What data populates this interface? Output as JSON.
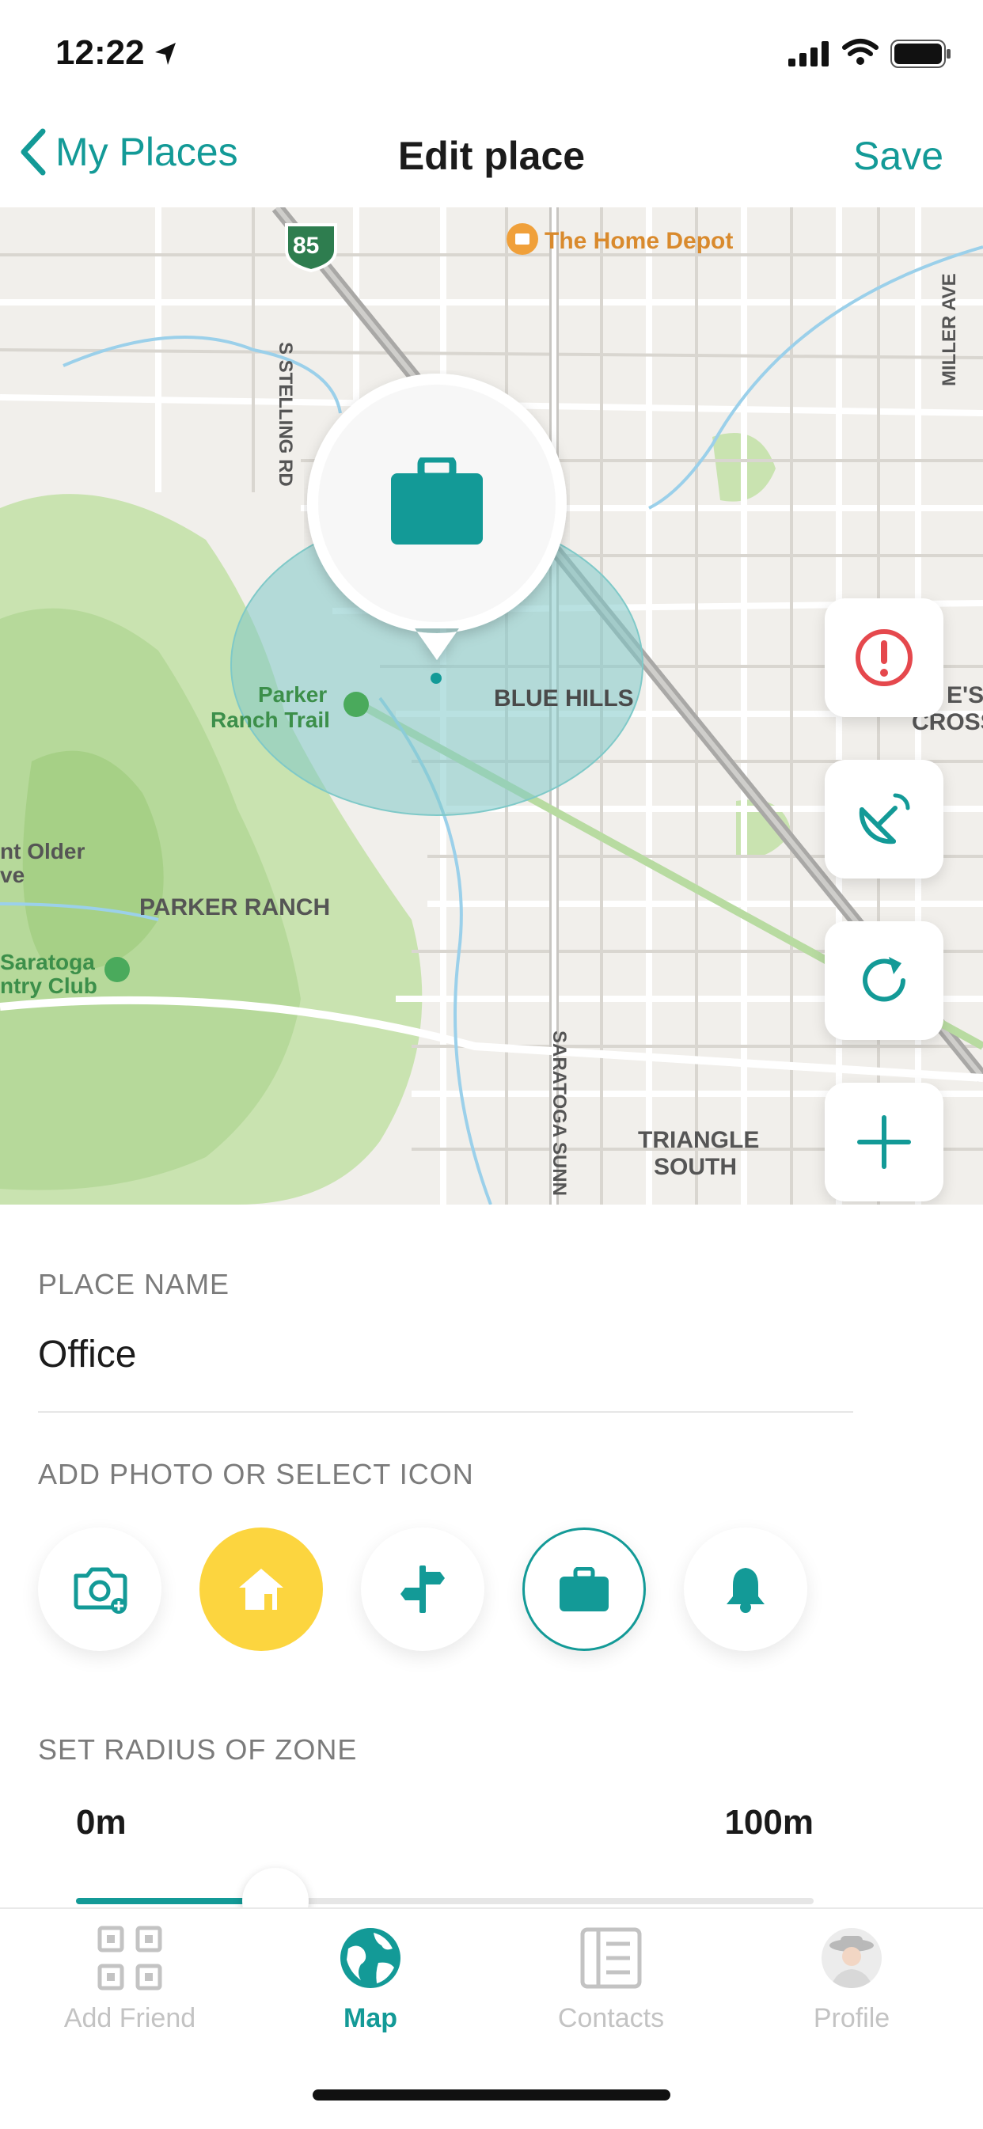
{
  "status_bar": {
    "time": "12:22"
  },
  "nav": {
    "back_label": "My Places",
    "title": "Edit place",
    "save_label": "Save"
  },
  "map": {
    "labels": {
      "home_depot": "The Home Depot",
      "highway": "85",
      "stelling": "S STELLING RD",
      "miller": "MILLER AVE",
      "blue_hills": "BLUE HILLS",
      "crossing_1": "E'S",
      "crossing_2": "CROSSING",
      "parker_trail_1": "Parker",
      "parker_trail_2": "Ranch Trail",
      "older_1": "nt Older",
      "older_2": "ve",
      "parker_ranch": "PARKER RANCH",
      "saratoga_1": "Saratoga",
      "saratoga_2": "ntry Club",
      "saratoga_sunn": "SARATOGA SUNN",
      "triangle_1": "TRIANGLE",
      "triangle_2": "SOUTH"
    },
    "selected_icon": "briefcase-icon",
    "controls": [
      "alert-icon",
      "satellite-icon",
      "refresh-icon",
      "plus-icon"
    ]
  },
  "form": {
    "place_name_label": "PLACE NAME",
    "place_name_value": "Office",
    "icon_section_label": "ADD PHOTO OR SELECT ICON",
    "icon_options": [
      "camera-add-icon",
      "home-icon",
      "signpost-icon",
      "briefcase-icon",
      "bell-icon"
    ],
    "selected_option": "briefcase-icon",
    "radius_label": "SET RADIUS OF ZONE",
    "radius_min": "0m",
    "radius_max": "100m",
    "radius_fraction": 0.27
  },
  "tabbar": {
    "tabs": [
      {
        "label": "Add Friend",
        "icon": "qr-code-icon"
      },
      {
        "label": "Map",
        "icon": "globe-icon"
      },
      {
        "label": "Contacts",
        "icon": "contacts-icon"
      },
      {
        "label": "Profile",
        "icon": "avatar"
      }
    ],
    "active": "Map"
  },
  "colors": {
    "accent": "#139a97",
    "alert": "#e5484d",
    "home_yellow": "#fcd53f",
    "zone_fill": "#7fc9c8"
  }
}
